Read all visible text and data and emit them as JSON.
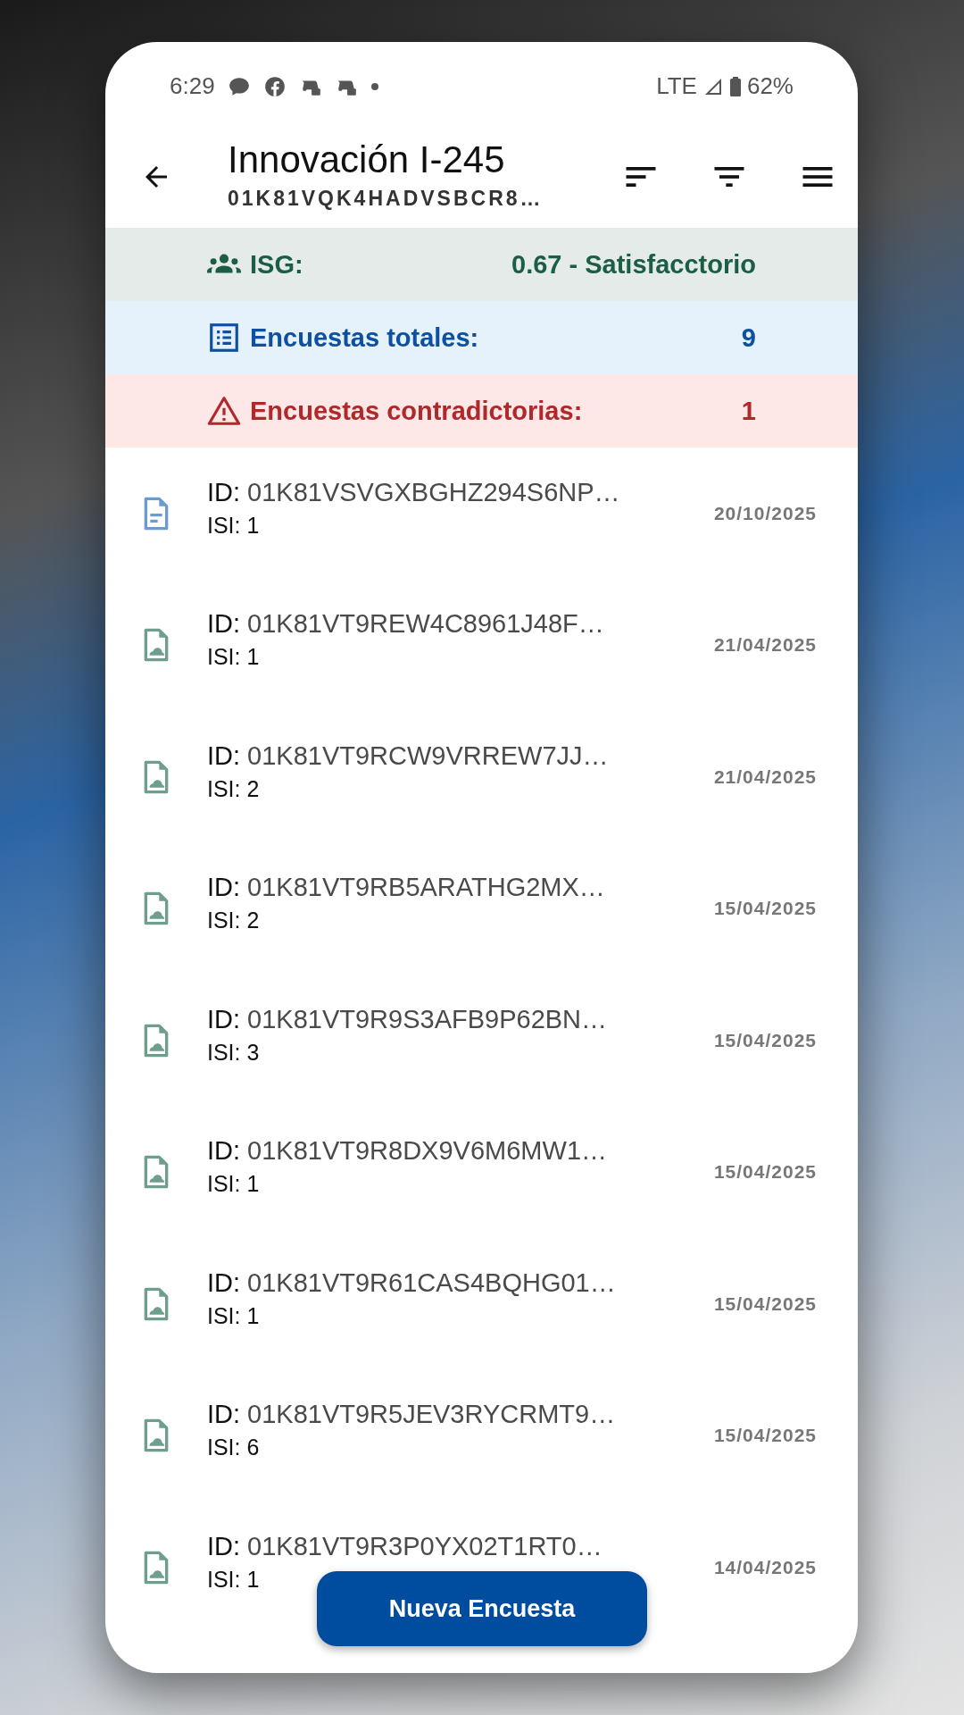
{
  "status_bar": {
    "time": "6:29",
    "network": "LTE",
    "battery": "62%"
  },
  "header": {
    "title": "Innovación I-245",
    "subtitle": "01K81VQK4HADVSBCR8…"
  },
  "summary": [
    {
      "kind": "isg",
      "label": "ISG:",
      "value": "0.67 - Satisfacctorio"
    },
    {
      "kind": "total",
      "label": "Encuestas totales:",
      "value": "9"
    },
    {
      "kind": "contradictory",
      "label": "Encuestas contradictorias:",
      "value": "1"
    }
  ],
  "surveys": [
    {
      "kind": "document",
      "id_label": "ID:",
      "id": "01K81VSVGXBGHZ294S6NP…",
      "isi": "ISI: 1",
      "date": "20/10/2025"
    },
    {
      "kind": "image",
      "id_label": "ID:",
      "id": "01K81VT9REW4C8961J48F…",
      "isi": "ISI: 1",
      "date": "21/04/2025"
    },
    {
      "kind": "image",
      "id_label": "ID:",
      "id": "01K81VT9RCW9VRREW7JJ…",
      "isi": "ISI: 2",
      "date": "21/04/2025"
    },
    {
      "kind": "image",
      "id_label": "ID:",
      "id": "01K81VT9RB5ARATHG2MX…",
      "isi": "ISI: 2",
      "date": "15/04/2025"
    },
    {
      "kind": "image",
      "id_label": "ID:",
      "id": "01K81VT9R9S3AFB9P62BN…",
      "isi": "ISI: 3",
      "date": "15/04/2025"
    },
    {
      "kind": "image",
      "id_label": "ID:",
      "id": "01K81VT9R8DX9V6M6MW1…",
      "isi": "ISI: 1",
      "date": "15/04/2025"
    },
    {
      "kind": "image",
      "id_label": "ID:",
      "id": "01K81VT9R61CAS4BQHG01…",
      "isi": "ISI: 1",
      "date": "15/04/2025"
    },
    {
      "kind": "image",
      "id_label": "ID:",
      "id": "01K81VT9R5JEV3RYCRMT9…",
      "isi": "ISI: 6",
      "date": "15/04/2025"
    },
    {
      "kind": "image",
      "id_label": "ID:",
      "id": "01K81VT9R3P0YX02T1RT0…",
      "isi": "ISI: 1",
      "date": "14/04/2025"
    }
  ],
  "new_survey_button": "Nueva Encuesta"
}
